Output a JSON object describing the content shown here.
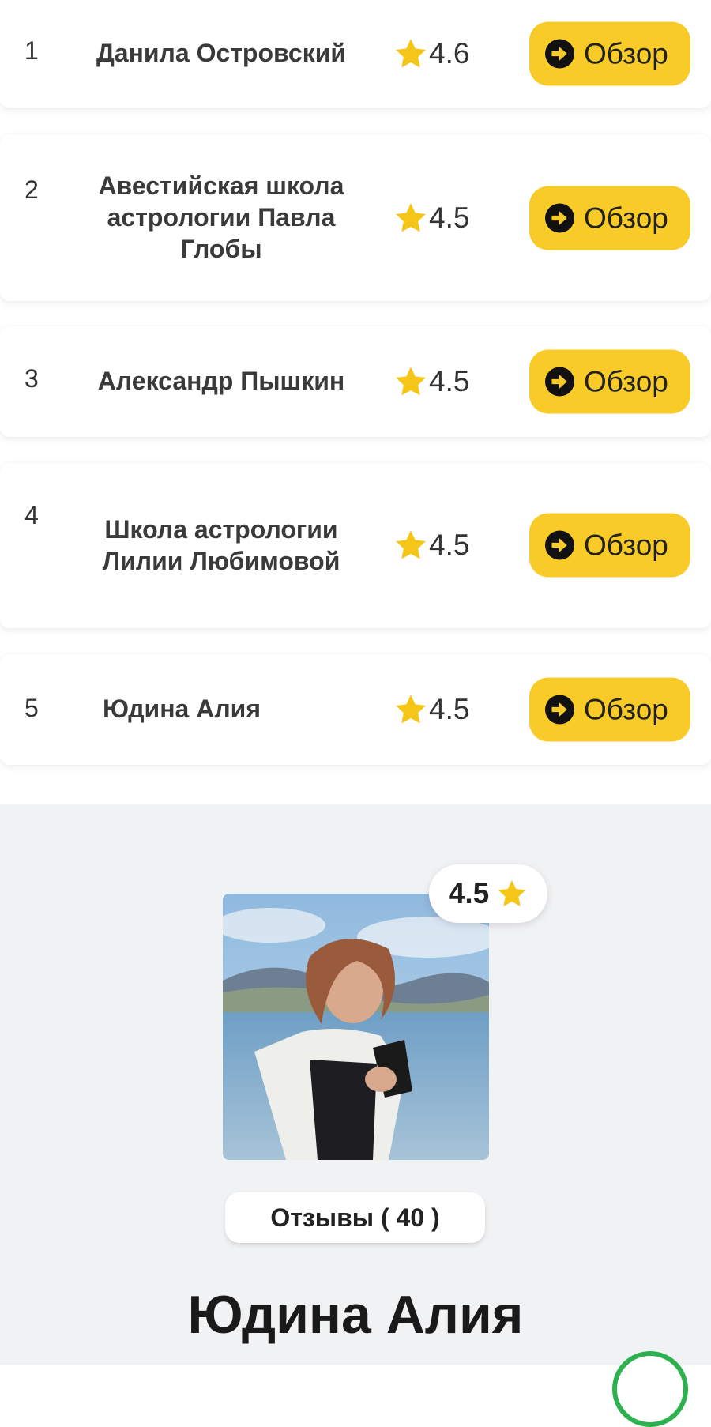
{
  "ranking": {
    "button_label": "Обзор",
    "items": [
      {
        "rank": "1",
        "name": "Данила Островский",
        "rating": "4.6"
      },
      {
        "rank": "2",
        "name": "Авестийская школа астрологии Павла Глобы",
        "rating": "4.5"
      },
      {
        "rank": "3",
        "name": "Александр Пышкин",
        "rating": "4.5"
      },
      {
        "rank": "4",
        "name": "Школа астрологии Лилии Любимовой",
        "rating": "4.5"
      },
      {
        "rank": "5",
        "name": "Юдина Алия",
        "rating": "4.5"
      }
    ]
  },
  "profile": {
    "rating": "4.5",
    "reviews_label": "Отзывы ( 40 )",
    "name": "Юдина Алия"
  },
  "colors": {
    "accent": "#f9cb28",
    "star": "#f5c518",
    "section_bg": "#f1f2f4",
    "chat_ring": "#2db14f"
  },
  "icons": {
    "rating_star": "star-icon",
    "review_button": "arrow-right-circle-icon",
    "floating": "chat-icon"
  }
}
